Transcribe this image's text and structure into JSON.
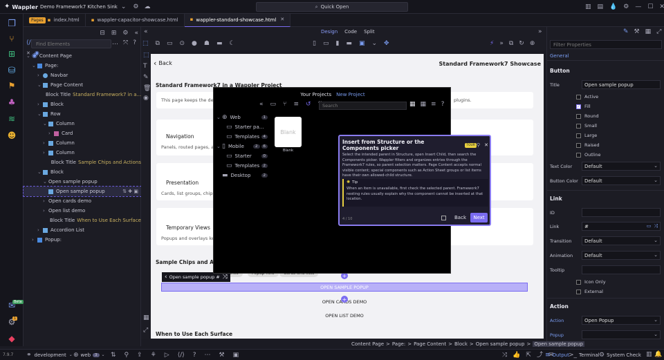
{
  "app": {
    "name": "Wappler",
    "project": "Demo Framework7 Kitchen Sink",
    "quick_open": "Quick Open"
  },
  "tabs": [
    {
      "badge": "Pages",
      "label": "index.html"
    },
    {
      "label": "wappler-capacitor-showcase.html"
    },
    {
      "label": "wappler-standard-showcase.html"
    }
  ],
  "modes": {
    "design": "Design",
    "code": "Code",
    "split": "Split"
  },
  "structure": {
    "find_placeholder": "Find Elements",
    "rows": [
      {
        "label": "Content Page"
      },
      {
        "label": "Page:"
      },
      {
        "label": "Navbar"
      },
      {
        "label": "Page Content"
      },
      {
        "label": "Block Title",
        "extra": "Standard Framework7 in a..."
      },
      {
        "label": "Block"
      },
      {
        "label": "Row"
      },
      {
        "label": "Column"
      },
      {
        "label": "Card"
      },
      {
        "label": "Column"
      },
      {
        "label": "Column"
      },
      {
        "label": "Block Title",
        "extra": "Sample Chips and Actions"
      },
      {
        "label": "Block"
      },
      {
        "label": "Open sample popup"
      },
      {
        "label": "Open sample popup"
      },
      {
        "label": "Open cards demo"
      },
      {
        "label": "Open list demo"
      },
      {
        "label": "Block Title",
        "extra": "When to Use Each Surface"
      },
      {
        "label": "Accordion List"
      },
      {
        "label": "Popup:"
      }
    ]
  },
  "canvas": {
    "back": "Back",
    "nav_title": "Standard Framework7 Showcase",
    "block_title": "Standard Framework7 in a Wappler Project",
    "intro": "This page keeps the defau",
    "intro_tail": "plugins.",
    "cards": [
      {
        "title": "Navigation",
        "text": "Panels, routed pages, and"
      },
      {
        "title": "Presentation",
        "text": "Cards, list groups, chips, a"
      },
      {
        "title": "Temporary Views",
        "text": "Popups and overlays keep"
      }
    ],
    "chips_title": "Sample Chips and Actio",
    "chips": [
      "ction lines",
      "Popup flow",
      "Cards and lists"
    ],
    "selected_label": "Open sample popup #",
    "open_popup_btn": "OPEN SAMPLE POPUP",
    "open_cards_btn": "OPEN CARDS DEMO",
    "open_list_btn": "OPEN LIST DEMO",
    "surface_title": "When to Use Each Surface"
  },
  "project_modal": {
    "your_projects": "Your Projects",
    "new_project": "New Project",
    "search_placeholder": "Search",
    "tree": [
      {
        "label": "Web",
        "count": "1"
      },
      {
        "label": "Starter pa..."
      },
      {
        "label": "Templates",
        "count": "4"
      },
      {
        "label": "Mobile",
        "count": "2"
      },
      {
        "label": "Starter",
        "count": "0"
      },
      {
        "label": "Templates",
        "count": "2"
      },
      {
        "label": "Desktop",
        "count": "2"
      }
    ],
    "count_mobile_extra": "6",
    "blank_tile": "Blank",
    "blank_caption": "Blank"
  },
  "tour": {
    "title": "Insert from Structure or the Components picker",
    "badge": "TOUR",
    "body": "Select the intended parent in Structure, open Insert Child, then search the Components picker. Wappler filters and organizes entries through the Framework7 rules, so parent selection matters. Page Content accepts normal visible content; special components such as Action Sheet groups or list items have their own allowed-child structure.",
    "tip_label": "Tip",
    "tip_body": "When an item is unavailable, first check the selected parent. Framework7 nesting rules usually explain why the component cannot be inserted at that location.",
    "progress": "4 / 10",
    "back": "Back",
    "next": "Next"
  },
  "props": {
    "filter_placeholder": "Filter Properties",
    "tab": "General",
    "button_header": "Button",
    "title_label": "Title",
    "title_value": "Open sample popup",
    "checks": [
      {
        "label": "Active",
        "on": false
      },
      {
        "label": "Fill",
        "on": true
      },
      {
        "label": "Round",
        "on": false
      },
      {
        "label": "Small",
        "on": false
      },
      {
        "label": "Large",
        "on": false
      },
      {
        "label": "Raised",
        "on": false
      },
      {
        "label": "Outline",
        "on": false
      }
    ],
    "text_color_label": "Text Color",
    "text_color_value": "Default",
    "button_color_label": "Button Color",
    "button_color_value": "Default",
    "link_header": "Link",
    "id_label": "ID",
    "link_label": "Link",
    "link_value": "#",
    "transition_label": "Transition",
    "transition_value": "Default",
    "animation_label": "Animation",
    "animation_value": "Default",
    "tooltip_label": "Tooltip",
    "icon_only": "Icon Only",
    "external": "External",
    "action_header": "Action",
    "action_label": "Action",
    "action_value": "Open Popup",
    "popup_label": "Popup"
  },
  "breadcrumb": {
    "items": [
      "Content Page",
      "Page:",
      "Page Content",
      "Block",
      "Open sample popup"
    ],
    "current": "Open sample popup"
  },
  "status": {
    "version": "7.9.7",
    "target": "development",
    "web": "web",
    "web_count": "3",
    "output": "Output",
    "terminal": "Terminal",
    "system_check": "System Check"
  },
  "rail_badges": {
    "beta": "Beta",
    "one": "1"
  },
  "colors": {
    "accent": "#7a6cf0",
    "tour_border": "#8a7cf0",
    "bg": "#1b1b23"
  }
}
